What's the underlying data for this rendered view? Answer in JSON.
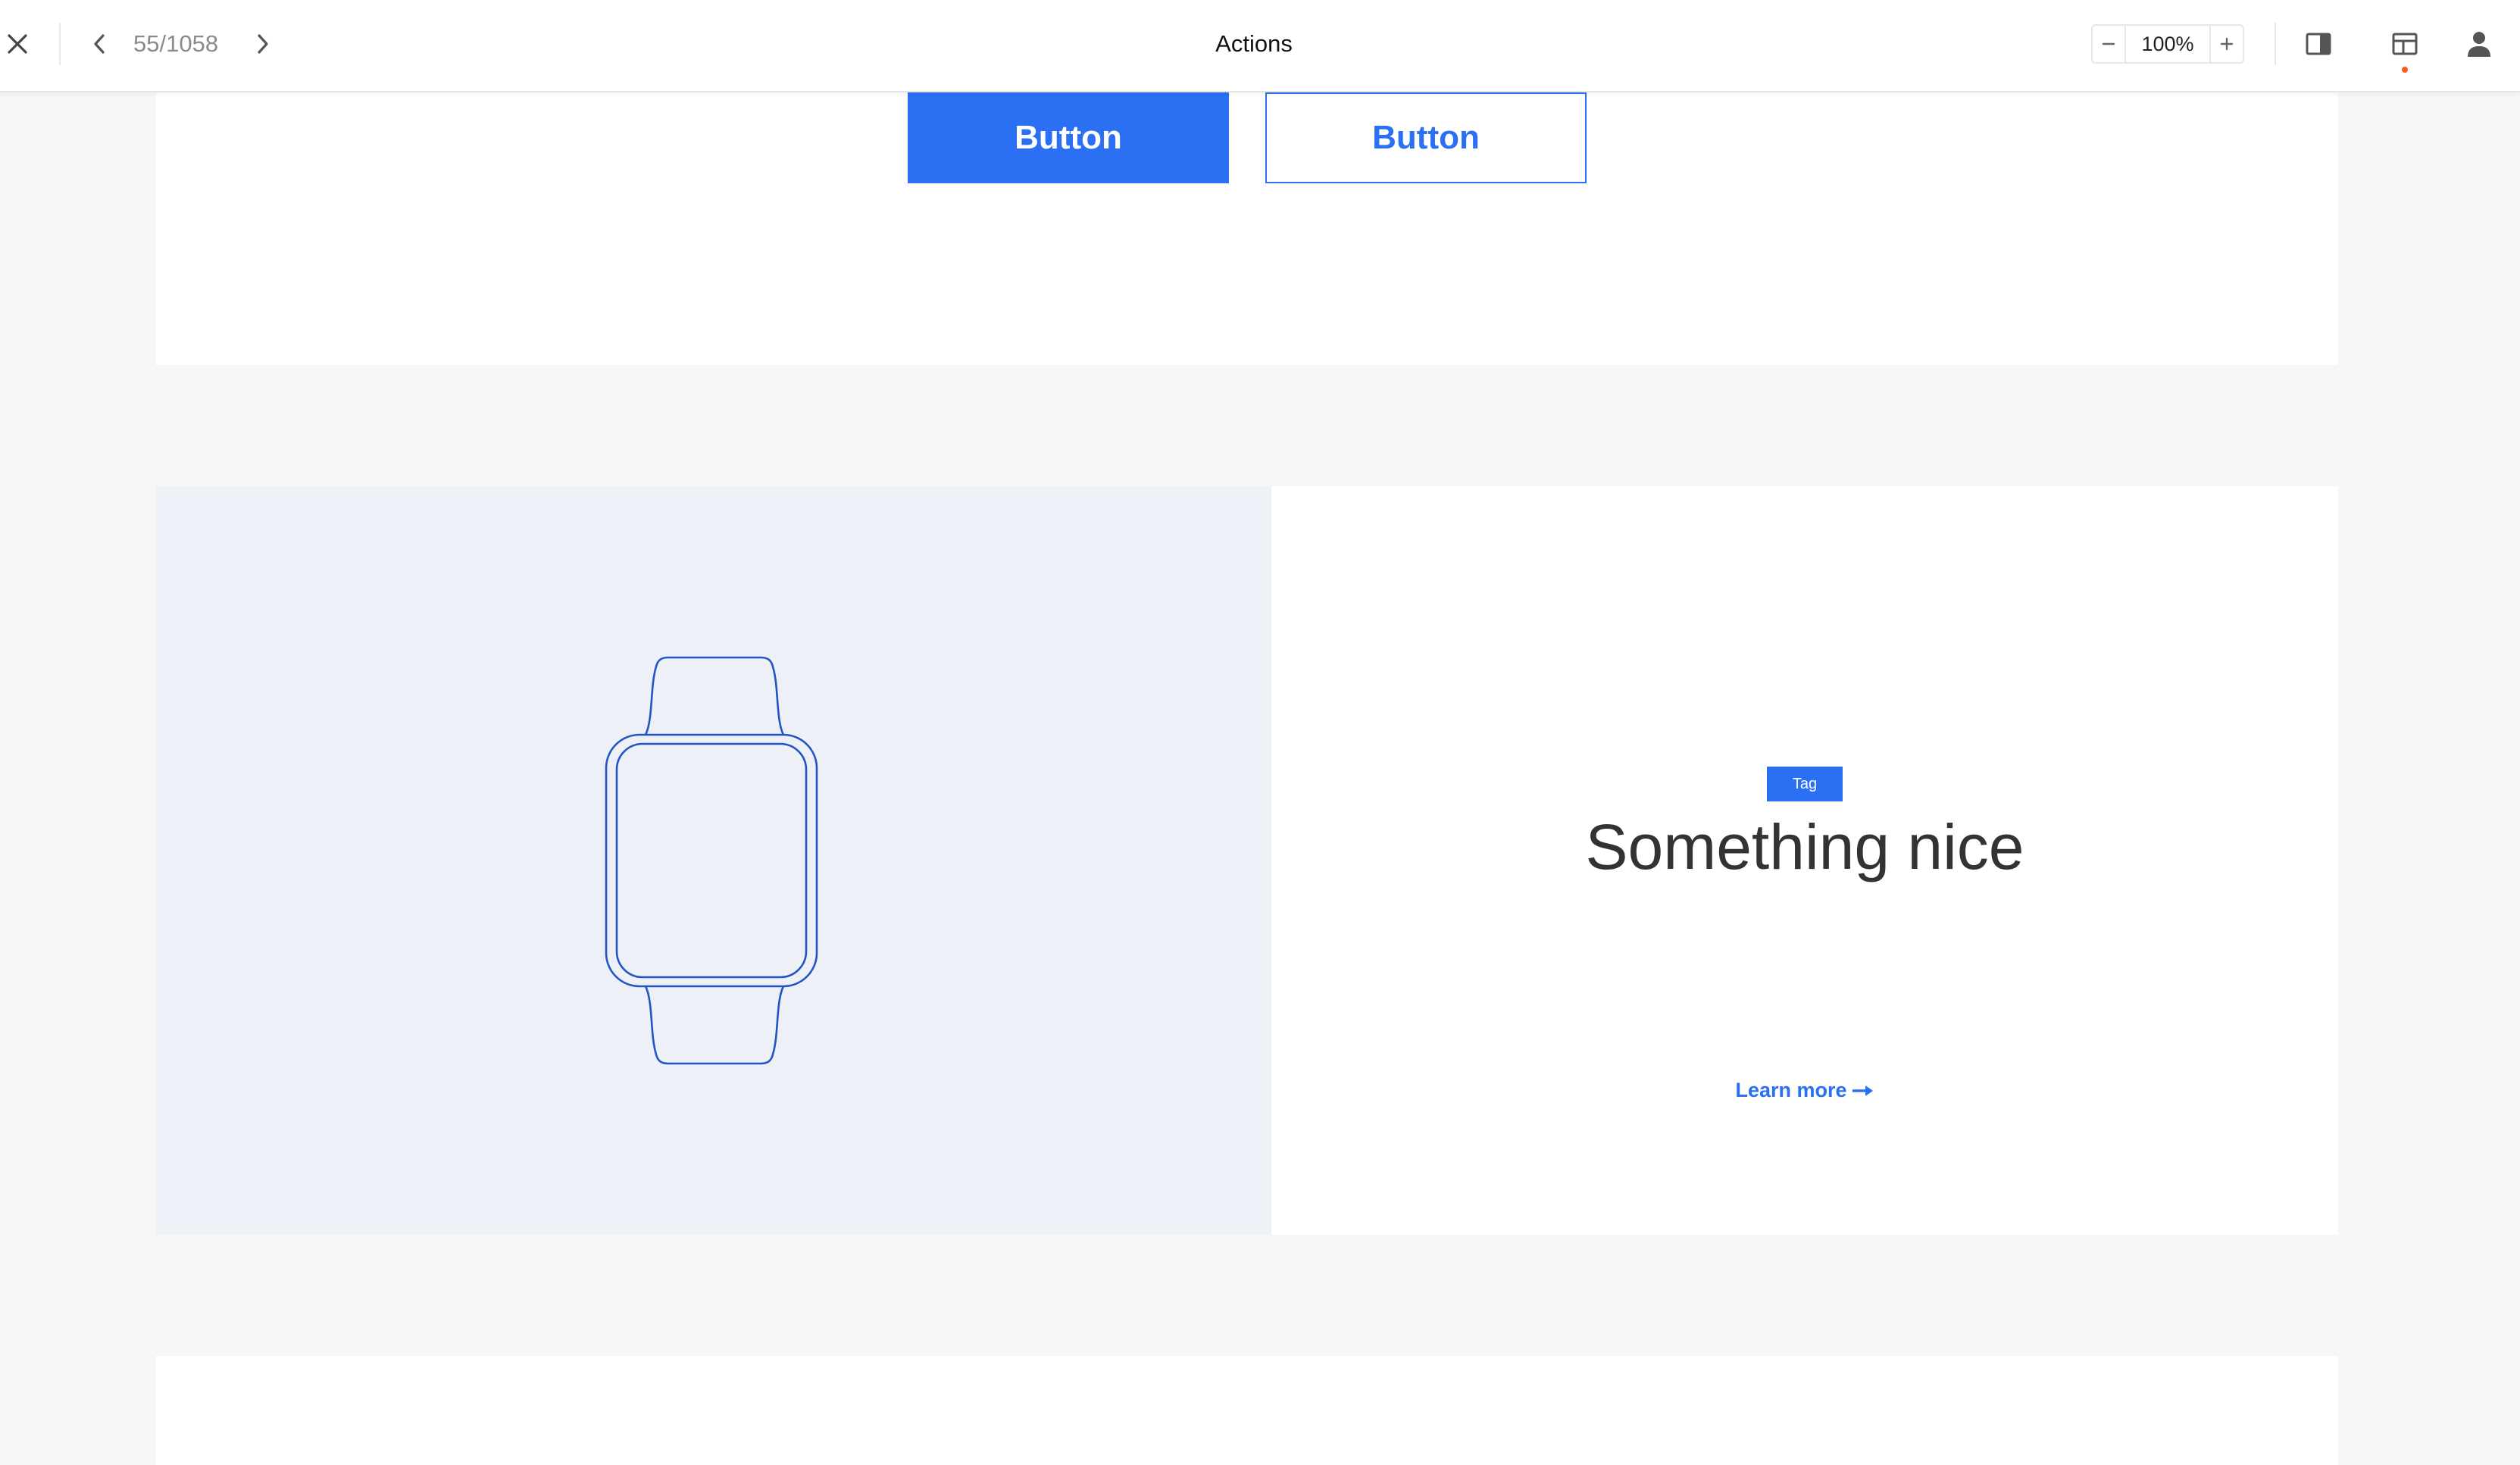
{
  "toolbar": {
    "page_counter": "55/1058",
    "title": "Actions",
    "zoom": "100%"
  },
  "actions": {
    "primary_label": "Button",
    "secondary_label": "Button"
  },
  "card": {
    "tag": "Tag",
    "title": "Something nice",
    "link_label": "Learn more"
  },
  "icons": {
    "close": "close-icon",
    "prev": "chevron-left-icon",
    "next": "chevron-right-icon",
    "zoom_out": "minus-icon",
    "zoom_in": "plus-icon",
    "panel": "side-panel-icon",
    "layout": "layout-icon",
    "user": "user-icon",
    "watch": "smartwatch-icon",
    "arrow": "arrow-right-icon"
  },
  "colors": {
    "accent": "#2b6ff2",
    "media_background": "#edf1f7",
    "band_gray": "#f6f6f6",
    "notification_dot": "#ff5a1f"
  }
}
